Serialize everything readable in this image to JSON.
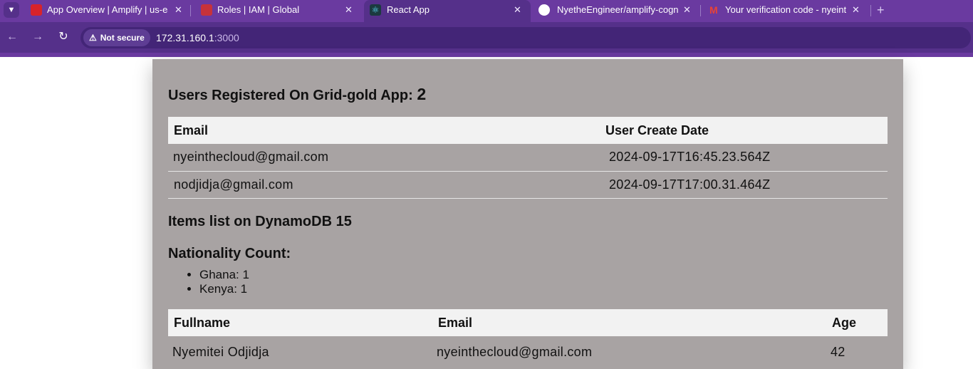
{
  "browser": {
    "tabs": [
      {
        "title": "App Overview | Amplify | us-eas",
        "favicon_color": "#d8232a"
      },
      {
        "title": "Roles | IAM | Global",
        "favicon_color": "#c7323a"
      },
      {
        "title": "React App",
        "favicon_color": "#1b3a3f",
        "active": true
      },
      {
        "title": "NyetheEngineer/amplify-cognit",
        "favicon_color": "#ffffff"
      },
      {
        "title": "Your verification code - nyeinthe",
        "favicon_color": "#ea4335"
      }
    ],
    "security_label": "Not secure",
    "url_host": "172.31.160.1",
    "url_port": ":3000"
  },
  "page": {
    "users_heading": "Users Registered On Grid-gold App:",
    "users_count": "2",
    "users_table": {
      "headers": [
        "Email",
        "User Create Date"
      ],
      "rows": [
        [
          "nyeinthecloud@gmail.com",
          "2024-09-17T16:45.23.564Z"
        ],
        [
          "nodjidja@gmail.com",
          "2024-09-17T17:00.31.464Z"
        ]
      ]
    },
    "items_heading": "Items list on DynamoDB 15",
    "nationality_heading": "Nationality Count:",
    "nationalities": [
      "Ghana: 1",
      "Kenya: 1"
    ],
    "people_table": {
      "headers": [
        "Fullname",
        "Email",
        "Age"
      ],
      "rows": [
        [
          "Nyemitei Odjidja",
          "nyeinthecloud@gmail.com",
          "42"
        ]
      ]
    }
  },
  "colors": {
    "chrome_purple": "#6a3aa0",
    "toolbar_purple": "#55308a",
    "panel_gray": "#a8a3a3",
    "table_header": "#f2f2f2"
  }
}
